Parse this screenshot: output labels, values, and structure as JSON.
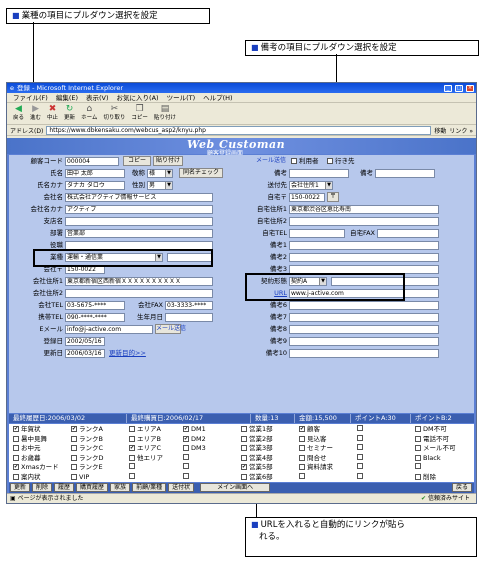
{
  "callouts": {
    "c1": "業種の項目にプルダウン選択を設定",
    "c2": "備考の項目にプルダウン選択を設定",
    "c3a": "URLを入れると自動的にリンクが貼ら",
    "c3b": "れる。",
    "bullet": "■"
  },
  "window": {
    "title": "登録 - Microsoft Internet Explorer",
    "menu": [
      "ファイル(F)",
      "編集(E)",
      "表示(V)",
      "お気に入り(A)",
      "ツール(T)",
      "ヘルプ(H)"
    ],
    "toolbar": [
      "戻る",
      "進む",
      "中止",
      "更新",
      "ホーム",
      "切り取り",
      "コピー",
      "貼り付け"
    ],
    "address_label": "アドレス(D)",
    "address": "https://www.dbkensaku.com/webcus_asp2/knyu.php",
    "go": "移動",
    "links": "リンク »",
    "status": "ページが表示されました",
    "zone": "信頼済みサイト"
  },
  "banner": {
    "logo": "Web Customan",
    "sub": "顧客登録画面"
  },
  "form": {
    "code_label": "顧客コード",
    "code": "000004",
    "copy_btn": "コピー",
    "paste_btn": "貼り付け",
    "name_label": "氏名",
    "name": "田中 太郎",
    "title_label": "敬称",
    "title": "様",
    "samename_btn": "同名チェック",
    "kana_label": "氏名カナ",
    "kana": "タナカ タロウ",
    "sex_label": "性別",
    "sex": "男",
    "company_label": "会社名",
    "company": "株式会社アクティブ情報サービス",
    "company_kana_label": "会社名カナ",
    "company_kana": "アクティブ",
    "branch_label": "支店名",
    "branch": "",
    "dept_label": "部署",
    "dept": "営業部",
    "post_label": "役職",
    "post": "",
    "industry_label": "業種",
    "industry": "運輸・通信業",
    "zip_label": "会社〒",
    "zip": "150-0022",
    "addr1_label": "会社住所1",
    "addr1": "東京都新宿区西新宿ＸＸＸＸＸＸＸＸＸＸ",
    "addr2_label": "会社住所2",
    "addr2": "",
    "tel_label": "会社TEL",
    "tel": "03-5675-****",
    "fax_label": "会社FAX",
    "fax": "03-3333-****",
    "mobile_label": "携帯TEL",
    "mobile": "090-****-****",
    "birth_label": "生年月日",
    "birth": "",
    "email_label": "Eメール",
    "email": "info@j-active.com",
    "reg_label": "登録日",
    "reg": "2002/05/16",
    "upd_label": "更新日",
    "upd": "2006/03/16",
    "upd_link": "更新目的>>",
    "mail_btn": "メール送信",
    "user_label": "利用者",
    "dest_label": "行き先",
    "note_label": "備考",
    "send_label": "送付先",
    "send": "会社住所1",
    "hzip_label": "自宅〒",
    "hzip": "150-0022",
    "haddr1_label": "自宅住所1",
    "haddr1": "東京都渋谷区恵比寿南",
    "haddr2_label": "自宅住所2",
    "htel_label": "自宅TEL",
    "hfax_label": "自宅FAX",
    "notes": [
      "備考1",
      "備考2",
      "備考3"
    ],
    "contract_label": "契約形態",
    "contract": "契約A",
    "url_label": "URL",
    "url": "www.j-active.com",
    "notes2": [
      "備考6",
      "備考7",
      "備考8",
      "備考9",
      "備考10"
    ]
  },
  "stats": [
    "最終履歴日:2006/03/02",
    "最終購買日:2006/02/17",
    "数量:13",
    "金額:15,500",
    "ポイントA:30",
    "ポイントB:2"
  ],
  "checks": [
    [
      "年賀状",
      "ランクA",
      "エリアA",
      "DM1",
      "営業1部",
      "顧客",
      "",
      "DM不可"
    ],
    [
      "暑中見舞",
      "ランクB",
      "エリアB",
      "DM2",
      "営業2部",
      "見込客",
      "",
      "電話不可"
    ],
    [
      "お中元",
      "ランクC",
      "エリアC",
      "DM3",
      "営業3部",
      "セミナー",
      "",
      "メール不可"
    ],
    [
      "お歳暮",
      "ランクD",
      "他エリア",
      "",
      "営業4部",
      "問合せ",
      "",
      "Black"
    ],
    [
      "Xmasカード",
      "ランクE",
      "",
      "",
      "営業5部",
      "資料請求",
      "",
      ""
    ],
    [
      "案内状",
      "VIP",
      "",
      "",
      "営業6部",
      "",
      "",
      "削除"
    ]
  ],
  "checked": [
    "0-0",
    "0-1",
    "0-3",
    "0-5",
    "1-3",
    "2-2",
    "4-0",
    "4-4"
  ],
  "buttons": [
    "更新",
    "削除",
    "履歴",
    "購買履歴",
    "家族",
    "前顧/業種",
    "送付状",
    "メイン画面へ",
    "戻る"
  ]
}
